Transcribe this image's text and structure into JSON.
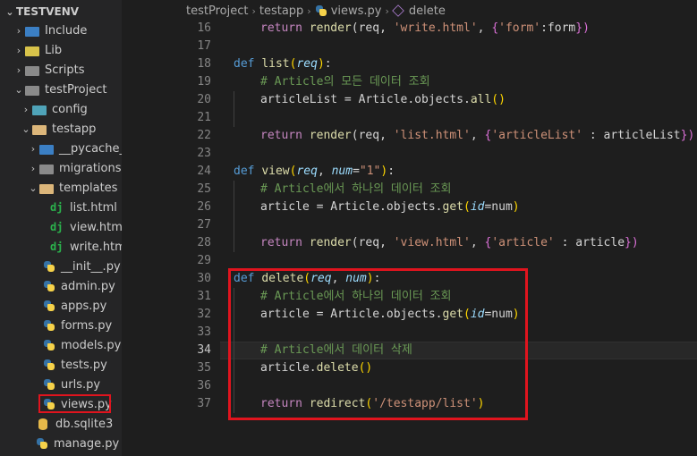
{
  "explorer": {
    "root": "TESTVENV",
    "items": [
      {
        "label": "Include",
        "type": "folder",
        "state": "collapsed"
      },
      {
        "label": "Lib",
        "type": "folder",
        "state": "collapsed"
      },
      {
        "label": "Scripts",
        "type": "folder",
        "state": "collapsed"
      },
      {
        "label": "testProject",
        "type": "folder",
        "state": "expanded"
      },
      {
        "label": "config",
        "type": "folder",
        "state": "collapsed"
      },
      {
        "label": "testapp",
        "type": "folder",
        "state": "expanded"
      },
      {
        "label": "__pycache__",
        "type": "folder",
        "state": "collapsed"
      },
      {
        "label": "migrations",
        "type": "folder",
        "state": "collapsed"
      },
      {
        "label": "templates",
        "type": "folder",
        "state": "expanded"
      },
      {
        "label": "list.html",
        "type": "django-file"
      },
      {
        "label": "view.html",
        "type": "django-file"
      },
      {
        "label": "write.html",
        "type": "django-file"
      },
      {
        "label": "__init__.py",
        "type": "python-file"
      },
      {
        "label": "admin.py",
        "type": "python-file"
      },
      {
        "label": "apps.py",
        "type": "python-file"
      },
      {
        "label": "forms.py",
        "type": "python-file"
      },
      {
        "label": "models.py",
        "type": "python-file"
      },
      {
        "label": "tests.py",
        "type": "python-file"
      },
      {
        "label": "urls.py",
        "type": "python-file"
      },
      {
        "label": "views.py",
        "type": "python-file",
        "selected": true
      },
      {
        "label": "db.sqlite3",
        "type": "database-file"
      },
      {
        "label": "manage.py",
        "type": "python-file"
      }
    ]
  },
  "breadcrumb": {
    "project": "testProject",
    "app": "testapp",
    "file": "views.py",
    "symbol": "delete"
  },
  "editor": {
    "active_line": "34",
    "lines": [
      {
        "n": "16"
      },
      {
        "n": "17"
      },
      {
        "n": "18"
      },
      {
        "n": "19"
      },
      {
        "n": "20"
      },
      {
        "n": "21"
      },
      {
        "n": "22"
      },
      {
        "n": "23"
      },
      {
        "n": "24"
      },
      {
        "n": "25"
      },
      {
        "n": "26"
      },
      {
        "n": "27"
      },
      {
        "n": "28"
      },
      {
        "n": "29"
      },
      {
        "n": "30"
      },
      {
        "n": "31"
      },
      {
        "n": "32"
      },
      {
        "n": "33"
      },
      {
        "n": "34"
      },
      {
        "n": "35"
      },
      {
        "n": "36"
      },
      {
        "n": "37"
      }
    ],
    "tokens": {
      "return": "return",
      "render": "render",
      "def": "def",
      "l16_a": "(req, ",
      "l16_s": "'write.html'",
      "l16_b": ", ",
      "l16_k": "'form'",
      "l16_c": ":form",
      "l16_e": "})",
      "l18_fn": "list",
      "l18_req": "req",
      "l19": "# Article의 모든 데이터 조회",
      "l20_a": "articleList = Article.objects.",
      "l20_f": "all",
      "l20_b": "()",
      "l22_s": "'list.html'",
      "l22_k": "'articleList'",
      "l22_c": " : articleList",
      "l24_fn": "view",
      "l24_req": "req",
      "l24_num": "num",
      "l24_def": "\"1\"",
      "l25": "# Article에서 하나의 데이터 조회",
      "l26_a": "article = Article.objects.",
      "l26_f": "get",
      "l26_id": "id",
      "l26_c": "num",
      "l28_s": "'view.html'",
      "l28_k": "'article'",
      "l28_c": " : article",
      "l30_fn": "delete",
      "l30_req": "req",
      "l30_num": "num",
      "l31": "# Article에서 하나의 데이터 조회",
      "l34": "# Article에서 데이터 삭제",
      "l35_a": "article.",
      "l35_f": "delete",
      "l37_f": "redirect",
      "l37_s": "'/testapp/list'"
    }
  },
  "colors": {
    "highlight": "#e0141e",
    "keyword": "#569cd6",
    "string": "#ce9178",
    "comment": "#6a9955"
  }
}
